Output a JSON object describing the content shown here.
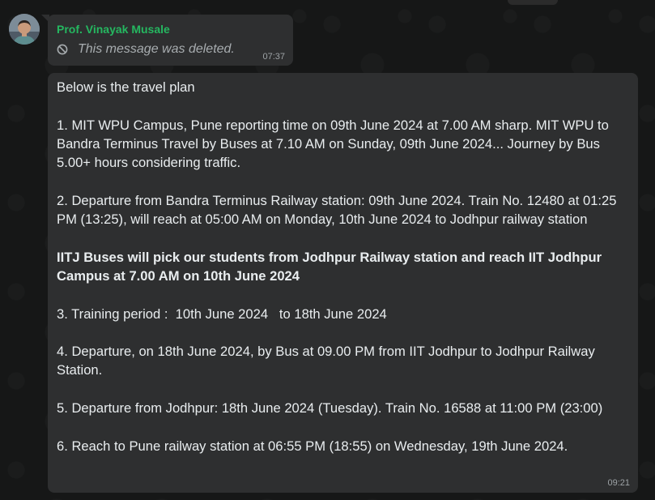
{
  "colors": {
    "background": "#161717",
    "bubble": "#2e2f30",
    "sender_name": "#25b760",
    "text": "#e9edef",
    "muted": "#a7acaf"
  },
  "messages": [
    {
      "sender": "Prof. Vinayak Musale",
      "avatar_icon": "profile-photo",
      "deleted_icon": "ban-icon",
      "text": "This message was deleted.",
      "time": "07:37"
    },
    {
      "paragraphs": [
        "Below is the travel plan",
        "1. MIT WPU Campus, Pune reporting time on 09th June 2024 at 7.00 AM sharp. MIT WPU to Bandra Terminus Travel by Buses at 7.10 AM on Sunday, 09th June 2024... Journey by Bus 5.00+ hours considering traffic.",
        "2. Departure from Bandra Terminus Railway station: 09th June 2024. Train No. 12480 at 01:25 PM (13:25), will reach at 05:00 AM on Monday, 10th June 2024 to Jodhpur railway station",
        "IITJ Buses will pick our students from Jodhpur Railway station and reach IIT Jodhpur Campus at 7.00 AM on 10th June 2024",
        "3. Training period :  10th June 2024   to 18th June 2024",
        "4. Departure, on 18th June 2024, by Bus at 09.00 PM from IIT Jodhpur to Jodhpur Railway Station.",
        "5. Departure from Jodhpur: 18th June 2024 (Tuesday). Train No. 16588 at 11:00 PM (23:00)",
        "6. Reach to Pune railway station at 06:55 PM (18:55) on Wednesday, 19th June 2024."
      ],
      "time": "09:21"
    }
  ]
}
